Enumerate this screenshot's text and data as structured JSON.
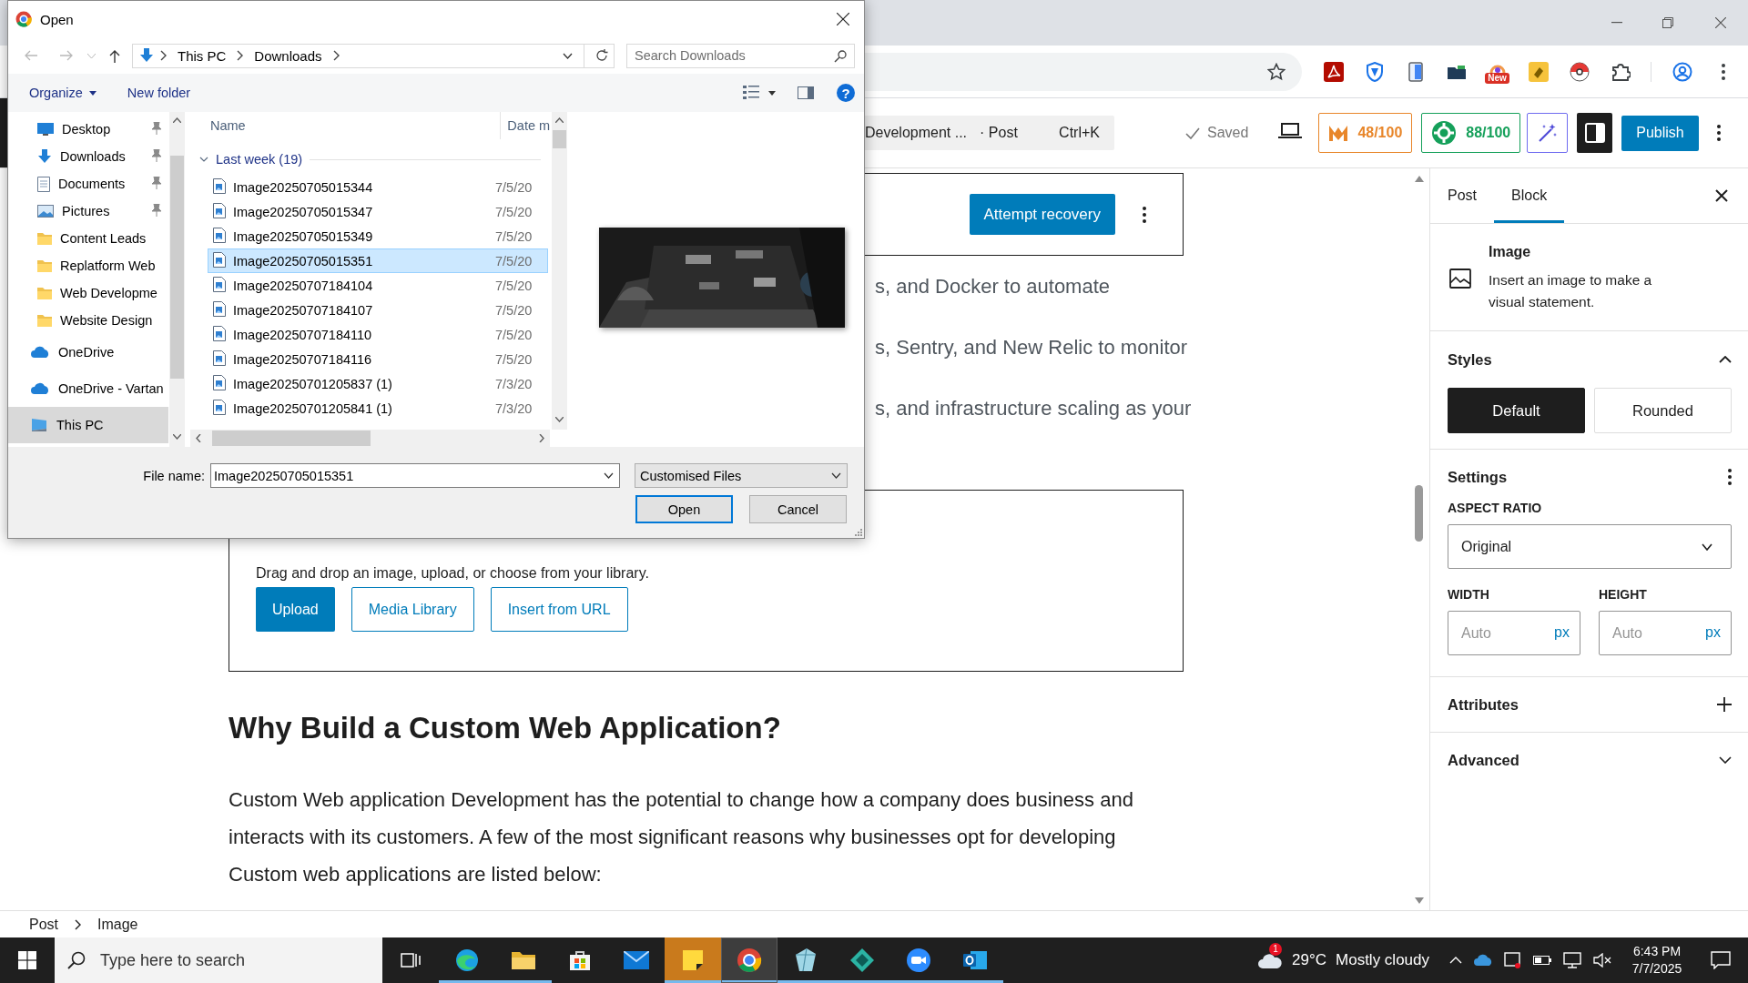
{
  "browser": {
    "new_badge": "New"
  },
  "editor_header": {
    "command_bar": {
      "title": "Development ...",
      "type": "· Post",
      "shortcut": "Ctrl+K"
    },
    "save_status": "Saved",
    "scores": [
      {
        "value": "48/100",
        "color": "#e8862a"
      },
      {
        "value": "88/100",
        "color": "#15a05a"
      }
    ],
    "publish": "Publish"
  },
  "editor": {
    "recovery_button": "Attempt recovery",
    "partial_lines": [
      "s, and Docker to automate",
      "s, Sentry, and New Relic to monitor",
      "s, and infrastructure scaling as your"
    ],
    "image_block": {
      "instructions": "Drag and drop an image, upload, or choose from your library.",
      "buttons": [
        {
          "label": "Upload",
          "kind": "primary"
        },
        {
          "label": "Media Library",
          "kind": "secondary"
        },
        {
          "label": "Insert from URL",
          "kind": "secondary"
        }
      ]
    },
    "heading": "Why Build a Custom Web Application?",
    "paragraph": "Custom Web application Development has the potential to change how a company does business and interacts with its customers. A few of the most significant reasons why businesses opt for developing Custom web applications are listed below:"
  },
  "breadcrumb": [
    "Post",
    "Image"
  ],
  "sidebar": {
    "tabs": [
      {
        "label": "Post",
        "selected": false
      },
      {
        "label": "Block",
        "selected": true
      }
    ],
    "block": {
      "title": "Image",
      "description": "Insert an image to make a visual statement."
    },
    "panels": [
      {
        "kind": "styles",
        "title": "Styles",
        "expanded": true,
        "options": [
          {
            "label": "Default",
            "selected": true
          },
          {
            "label": "Rounded",
            "selected": false
          }
        ]
      },
      {
        "kind": "settings",
        "title": "Settings",
        "aspect_label": "ASPECT RATIO",
        "aspect_value": "Original",
        "width_label": "WIDTH",
        "height_label": "HEIGHT",
        "width_placeholder": "Auto",
        "height_placeholder": "Auto",
        "width_unit": "px",
        "height_unit": "px"
      },
      {
        "kind": "attributes",
        "title": "Attributes"
      },
      {
        "kind": "collapsible",
        "title": "Advanced",
        "expanded": false
      }
    ]
  },
  "dialog": {
    "title": "Open",
    "address": [
      "This PC",
      "Downloads"
    ],
    "search_placeholder": "Search Downloads",
    "commands": [
      "Organize",
      "New folder"
    ],
    "help": "?",
    "nav": [
      {
        "label": "Desktop",
        "kind": "desktop",
        "pinned": true,
        "selected": false
      },
      {
        "label": "Downloads",
        "kind": "downloads",
        "pinned": true,
        "selected": false
      },
      {
        "label": "Documents",
        "kind": "documents",
        "pinned": true,
        "selected": false
      },
      {
        "label": "Pictures",
        "kind": "pictures",
        "pinned": true,
        "selected": false
      },
      {
        "label": "Content Leads",
        "kind": "folder",
        "pinned": false,
        "selected": false
      },
      {
        "label": "Replatform Web",
        "kind": "folder",
        "pinned": false,
        "selected": false
      },
      {
        "label": "Web Developme",
        "kind": "folder",
        "pinned": false,
        "selected": false
      },
      {
        "label": "Website Design",
        "kind": "folder",
        "pinned": false,
        "selected": false
      },
      {
        "label": "OneDrive",
        "kind": "cloud",
        "pinned": false,
        "selected": false
      },
      {
        "label": "OneDrive - Vartan",
        "kind": "cloud",
        "pinned": false,
        "selected": false
      },
      {
        "label": "This PC",
        "kind": "pc",
        "pinned": false,
        "selected": true
      }
    ],
    "columns": [
      "Name",
      "Date m"
    ],
    "group": {
      "label": "Last week (19)",
      "expanded": true
    },
    "files": [
      {
        "name": "Image20250705015344",
        "date": "7/5/20",
        "selected": false
      },
      {
        "name": "Image20250705015347",
        "date": "7/5/20",
        "selected": false
      },
      {
        "name": "Image20250705015349",
        "date": "7/5/20",
        "selected": false
      },
      {
        "name": "Image20250705015351",
        "date": "7/5/20",
        "selected": true
      },
      {
        "name": "Image20250707184104",
        "date": "7/5/20",
        "selected": false
      },
      {
        "name": "Image20250707184107",
        "date": "7/5/20",
        "selected": false
      },
      {
        "name": "Image20250707184110",
        "date": "7/5/20",
        "selected": false
      },
      {
        "name": "Image20250707184116",
        "date": "7/5/20",
        "selected": false
      },
      {
        "name": "Image20250701205837 (1)",
        "date": "7/3/20",
        "selected": false
      },
      {
        "name": "Image20250701205841 (1)",
        "date": "7/3/20",
        "selected": false
      }
    ],
    "file_name_label": "File name:",
    "file_name": "Image20250705015351",
    "file_type": "Customised Files",
    "buttons": [
      {
        "label": "Open",
        "kind": "default"
      },
      {
        "label": "Cancel",
        "kind": "normal"
      }
    ]
  },
  "taskbar": {
    "search_placeholder": "Type here to search",
    "apps": [
      {
        "kind": "edge",
        "running": true,
        "selected": false,
        "flashing": false
      },
      {
        "kind": "explorer",
        "running": true,
        "selected": false,
        "flashing": false
      },
      {
        "kind": "store",
        "running": false,
        "selected": false,
        "flashing": false
      },
      {
        "kind": "mail",
        "running": false,
        "selected": false,
        "flashing": false
      },
      {
        "kind": "notes",
        "running": true,
        "selected": false,
        "flashing": true
      },
      {
        "kind": "chrome",
        "running": true,
        "selected": true,
        "flashing": false
      },
      {
        "kind": "crystal",
        "running": true,
        "selected": false,
        "flashing": false
      },
      {
        "kind": "diamond",
        "running": true,
        "selected": false,
        "flashing": false
      },
      {
        "kind": "zoom",
        "running": true,
        "selected": false,
        "flashing": false
      },
      {
        "kind": "outlook",
        "running": true,
        "selected": false,
        "flashing": false
      }
    ],
    "weather": {
      "badge": "1",
      "temperature": "29°C",
      "condition": "Mostly cloudy"
    },
    "time": "6:43 PM",
    "date": "7/7/2025"
  }
}
